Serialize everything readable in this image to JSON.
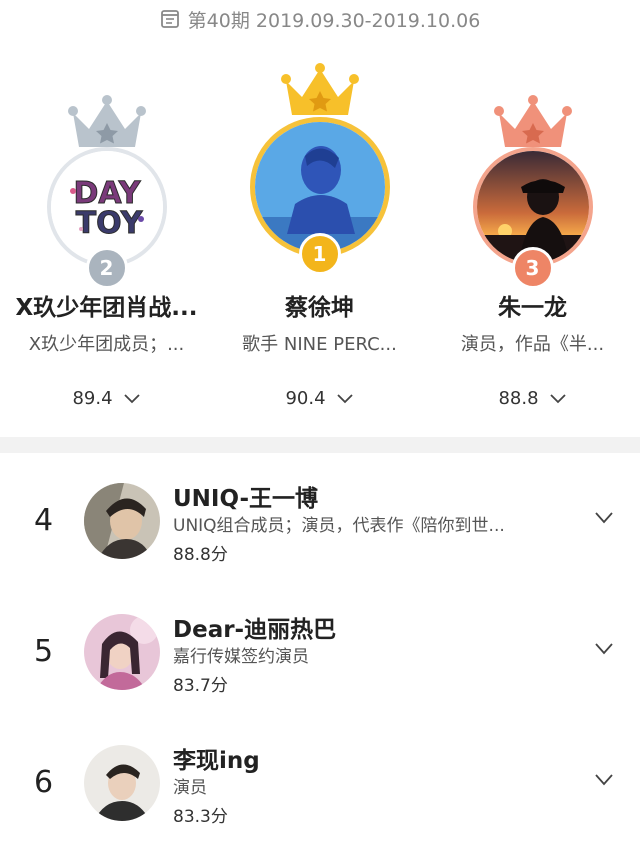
{
  "period": {
    "icon": "calendar-list-icon",
    "text": "第40期 2019.09.30-2019.10.06"
  },
  "podium": [
    {
      "rank": "2",
      "name": "X玖少年团肖战...",
      "desc": "X玖少年团成员；...",
      "score": "89.4",
      "avatar_text_1": "DAY",
      "avatar_text_2": "TOY",
      "crown_color": "#b9c3cc",
      "medal_color": "#aab4be"
    },
    {
      "rank": "1",
      "name": "蔡徐坤",
      "desc": "歌手 NINE PERC...",
      "score": "90.4",
      "crown_color": "#f7c02a",
      "medal_color": "#f3b51b"
    },
    {
      "rank": "3",
      "name": "朱一龙",
      "desc": "演员，作品《半...",
      "score": "88.8",
      "crown_color": "#f0917a",
      "medal_color": "#ee8566"
    }
  ],
  "list": [
    {
      "rank": "4",
      "name": "UNIQ-王一博",
      "desc": "UNIQ组合成员；演员，代表作《陪你到世...",
      "score": "88.8分"
    },
    {
      "rank": "5",
      "name": "Dear-迪丽热巴",
      "desc": "嘉行传媒签约演员",
      "score": "83.7分"
    },
    {
      "rank": "6",
      "name": "李现ing",
      "desc": "演员",
      "score": "83.3分"
    }
  ]
}
